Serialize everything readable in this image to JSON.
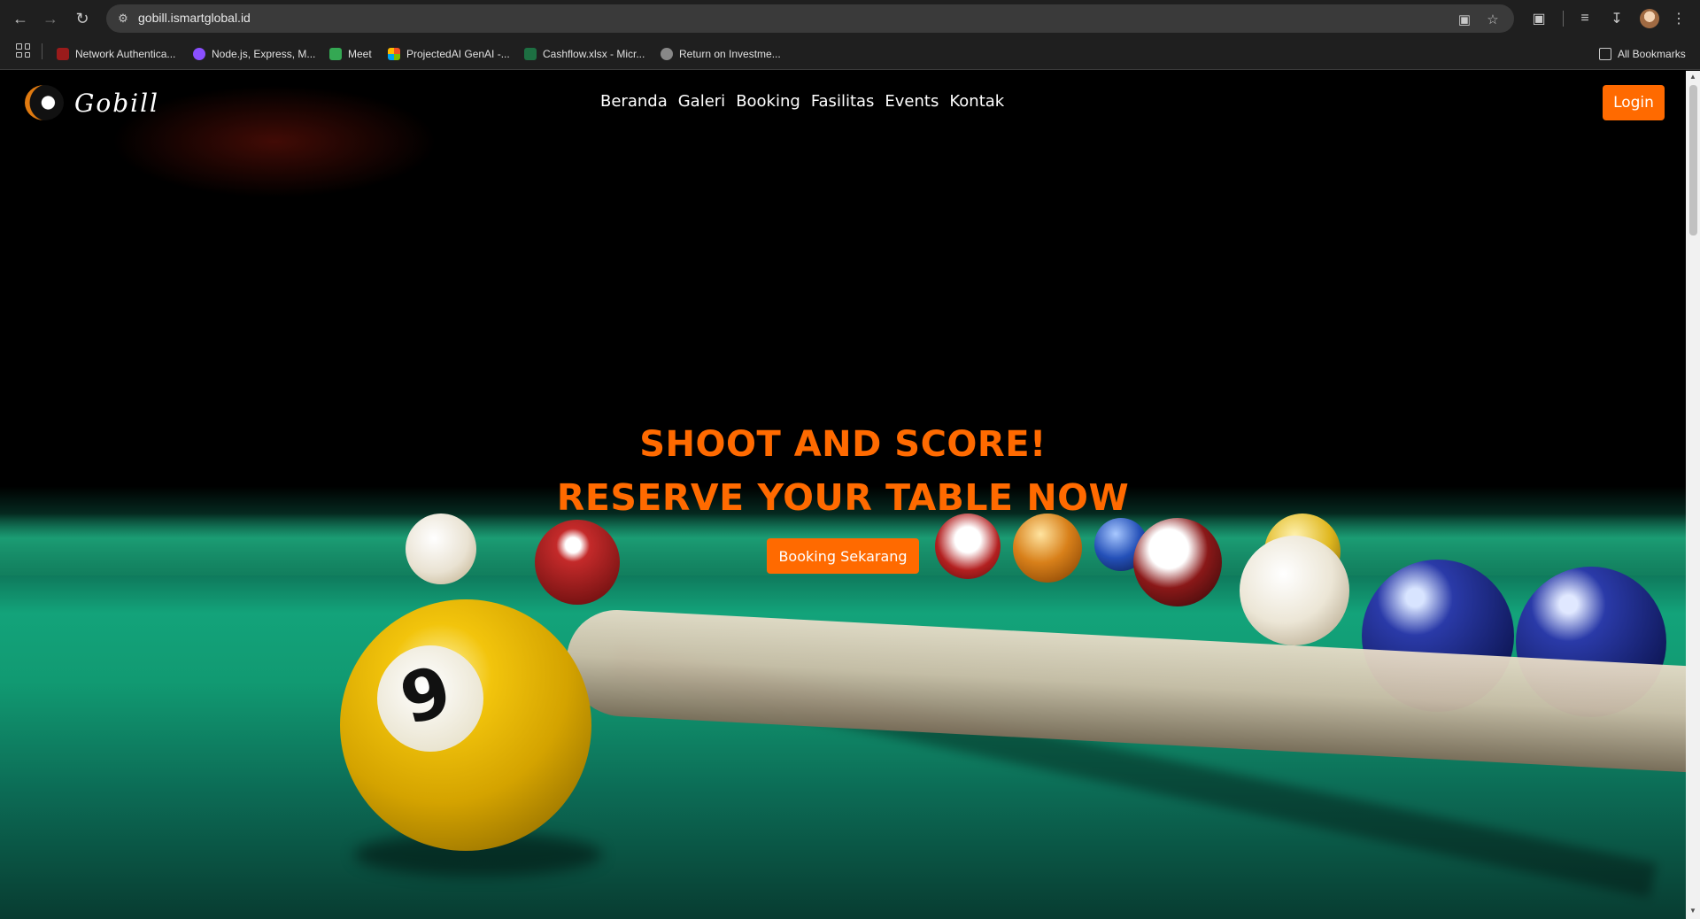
{
  "browser": {
    "url": "gobill.ismartglobal.id",
    "bookmarks": [
      {
        "label": "Network Authentica...",
        "color": "#9a1b1b"
      },
      {
        "label": "Node.js, Express, M...",
        "color": "#8a4fff"
      },
      {
        "label": "Meet",
        "color": "#34a853"
      },
      {
        "label": "ProjectedAI GenAI -...",
        "color": "#f25022"
      },
      {
        "label": "Cashflow.xlsx - Micr...",
        "color": "#1d6f42"
      },
      {
        "label": "Return on Investme...",
        "color": "#888888"
      }
    ],
    "all_bookmarks": "All Bookmarks"
  },
  "site": {
    "logo_text": "Gobill",
    "menu": [
      "Beranda",
      "Galeri",
      "Booking",
      "Fasilitas",
      "Events",
      "Kontak"
    ],
    "login_label": "Login",
    "hero_line1": "SHOOT AND SCORE!",
    "hero_line2": "RESERVE YOUR TABLE NOW",
    "cta_label": "Booking Sekarang",
    "ball_number": "9"
  },
  "colors": {
    "accent": "#ff6a00",
    "browser_bg": "#1f1f1f",
    "felt": "#13a37a"
  }
}
